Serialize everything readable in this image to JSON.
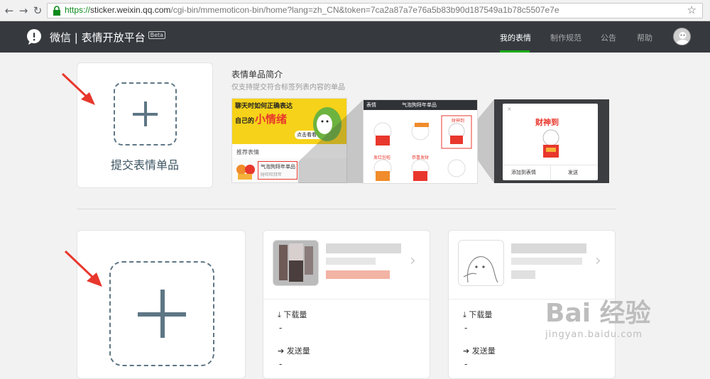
{
  "browser": {
    "url_protocol": "https://",
    "url_host": "sticker.weixin.qq.com",
    "url_path": "/cgi-bin/mmemoticon-bin/home?lang=zh_CN&token=7ca2a87a7e76a5b83b90d187549a1b78c5507e7e"
  },
  "header": {
    "brand": "微信 | 表情开放平台",
    "beta": "Beta",
    "nav": [
      "我的表情",
      "制作规范",
      "公告",
      "帮助"
    ],
    "active_index": 0
  },
  "submit_card": {
    "label": "提交表情单品"
  },
  "intro": {
    "title": "表情单品简介",
    "subtitle": "仅支持提交符合标签列表内容的单品",
    "banner_text_1": "聊天时如何正确表达",
    "banner_text_2": "自己的",
    "banner_text_3": "小情绪",
    "banner_button": "点击看看 →",
    "recommend_label": "推荐表情",
    "recommend_item": "气泡狗拜年单品",
    "recommend_sub": "财旺旺拜年",
    "chat_back": "表情",
    "chat_title": "气泡狗拜年单品",
    "sticker_labels": [
      "财神到",
      "发红包啦",
      "恭喜发财"
    ],
    "dialog_sticker": "财神到",
    "dialog_add": "添加到表情",
    "dialog_send": "发送"
  },
  "stickers": [
    {
      "downloads_label": "下载量",
      "downloads": "-",
      "sends_label": "发送量",
      "sends": "-"
    },
    {
      "downloads_label": "下载量",
      "downloads": "-",
      "sends_label": "发送量",
      "sends": "-"
    }
  ],
  "watermark": {
    "brand": "Bai 经验",
    "url": "jingyan.baidu.com"
  },
  "colors": {
    "header_bg": "#363a3f",
    "accent": "#1aad19",
    "plus": "#5e7685",
    "annotation_arrow": "#e8372c"
  }
}
